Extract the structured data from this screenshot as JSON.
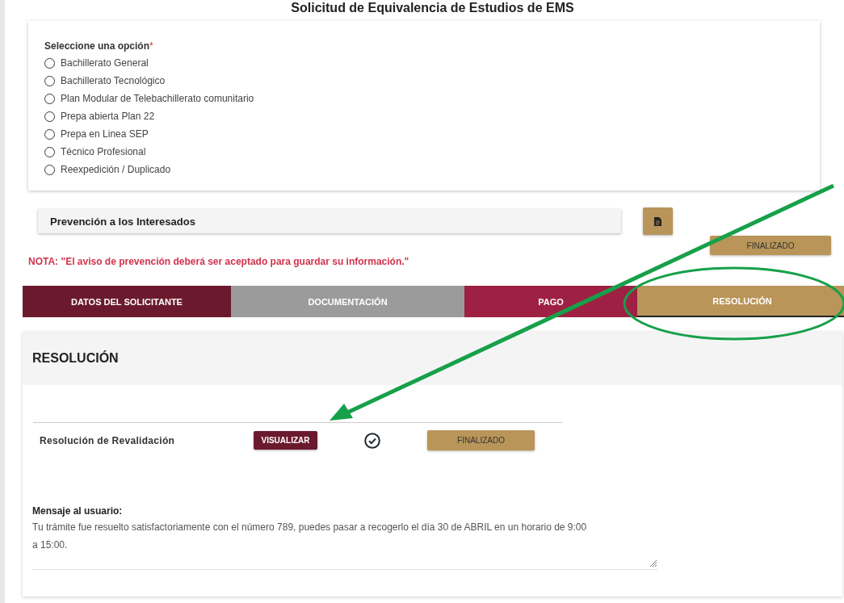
{
  "title": "Solicitud de Equivalencia de Estudios de EMS",
  "options_group": {
    "label": "Seleccione una opción",
    "required_mark": "*",
    "options": [
      {
        "label": "Bachillerato General",
        "selected": false
      },
      {
        "label": "Bachillerato Tecnológico",
        "selected": false
      },
      {
        "label": "Plan Modular de Telebachillerato comunitario",
        "selected": false
      },
      {
        "label": "Prepa abierta Plan 22",
        "selected": false
      },
      {
        "label": "Prepa en Linea SEP",
        "selected": false
      },
      {
        "label": "Técnico Profesional",
        "selected": false
      },
      {
        "label": "Reexpedición / Duplicado",
        "selected": false
      }
    ]
  },
  "prevention": {
    "title": "Prevención a los Interesados",
    "status_button": "FINALIZADO",
    "note": "NOTA: \"El aviso de prevención deberá ser aceptado para guardar su información.\""
  },
  "tabs": [
    {
      "label": "DATOS DEL SOLICITANTE",
      "color": "#6b1a2e",
      "selected": false
    },
    {
      "label": "DOCUMENTACIÓN",
      "color": "#9b9b9b",
      "selected": false
    },
    {
      "label": "PAGO",
      "color": "#9e2143",
      "selected": false
    },
    {
      "label": "RESOLUCIÓN",
      "color": "#b99559",
      "selected": true
    }
  ],
  "resolution": {
    "heading": "RESOLUCIÓN",
    "rows": [
      {
        "name": "Resolución de Revalidación",
        "view_button": "VISUALIZAR",
        "done": true,
        "status_button": "FINALIZADO"
      }
    ],
    "message_label": "Mensaje al usuario:",
    "message": "Tu trámite fue resuelto satisfactoriamente con el número 789, puedes pasar a recogerlo el día 30 de ABRIL en un horario de 9:00 a 15:00."
  }
}
